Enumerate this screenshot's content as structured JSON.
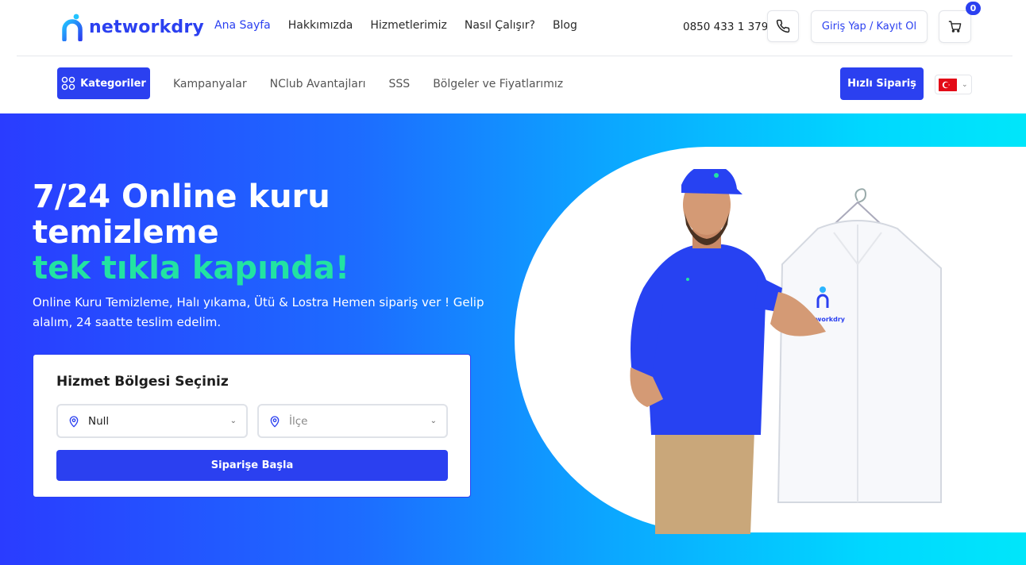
{
  "brand": {
    "name": "networkdry",
    "color": "#2b40f0",
    "accent": "#22e3a2"
  },
  "header": {
    "nav": [
      {
        "label": "Ana Sayfa",
        "active": true
      },
      {
        "label": "Hakkımızda",
        "active": false
      },
      {
        "label": "Hizmetlerimiz",
        "active": false
      },
      {
        "label": "Nasıl Çalışır?",
        "active": false
      },
      {
        "label": "Blog",
        "active": false
      }
    ],
    "phone": "0850 433 1 379",
    "phone_icon": "phone-icon",
    "login_label": "Giriş Yap / Kayıt Ol",
    "cart_icon": "cart-icon",
    "cart_count": "0"
  },
  "subnav": {
    "categories_label": "Kategoriler",
    "categories_icon": "grid-icon",
    "links": [
      "Kampanyalar",
      "NClub Avantajları",
      "SSS",
      "Bölgeler ve Fiyatlarımız"
    ],
    "quick_order_label": "Hızlı Sipariş",
    "language_icon": "turkey-flag-icon"
  },
  "hero": {
    "title_line1": "7/24 Online kuru",
    "title_line2": "temizleme",
    "title_accent": "tek tıkla kapında!",
    "subtitle": "Online Kuru Temizleme, Halı yıkama, Ütü & Lostra Hemen sipariş ver ! Gelip alalım, 24 saatte teslim edelim.",
    "illustration_logo_text": "networkdry"
  },
  "region_form": {
    "title": "Hizmet Bölgesi Seçiniz",
    "city_value": "Null",
    "district_placeholder": "İlçe",
    "start_label": "Siparişe Başla"
  }
}
